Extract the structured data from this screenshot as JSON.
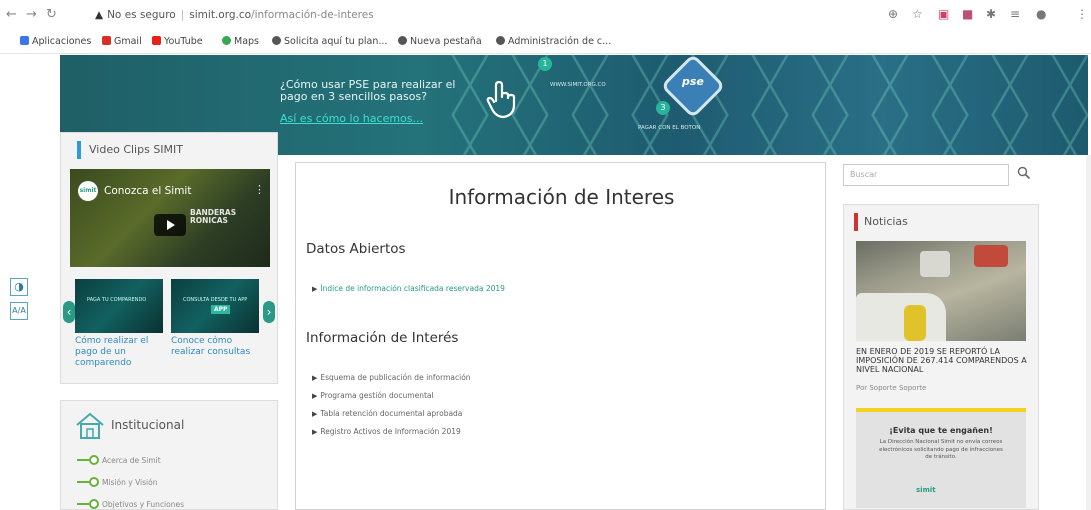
{
  "browser": {
    "security_label": "No es seguro",
    "url_domain": "simit.org.co",
    "url_path": "/información-de-interes"
  },
  "bookmarks": [
    {
      "label": "Aplicaciones",
      "color": "#3b78e7"
    },
    {
      "label": "Gmail",
      "color": "#d93025"
    },
    {
      "label": "YouTube",
      "color": "#e62117"
    },
    {
      "label": "Maps",
      "color": "#34a853"
    },
    {
      "label": "Solicita aquí tu plan...",
      "color": "#555555"
    },
    {
      "label": "Nueva pestaña",
      "color": "#555555"
    },
    {
      "label": "Administración de c...",
      "color": "#555555"
    }
  ],
  "banner": {
    "question": "¿Cómo usar PSE para realizar el pago en 3 sencillos pasos?",
    "link": "Así es cómo lo hacemos...",
    "pse": "pse",
    "small_url": "WWW.SIMIT.ORG.CO",
    "small_pay": "PAGAR CON EL BOTON"
  },
  "video_clips": {
    "title": "Video Clips SIMIT",
    "video_title": "Conozca el Simit",
    "logo": "simit",
    "overlay": "BANDERAS RONICAS",
    "thumbs": [
      {
        "caption": "Cómo realizar el pago de un comparendo",
        "text": "PAGA TU COMPARENDO"
      },
      {
        "caption": "Conoce cómo realizar consultas",
        "text": "CONSULTA DESDE TU APP",
        "app": "APP"
      }
    ]
  },
  "institucional": {
    "title": "Institucional",
    "items": [
      "Acerca de Simit",
      "Misión y Visión",
      "Objetivos y Funciones"
    ]
  },
  "main": {
    "title": "Información de Interes",
    "section1": "Datos Abiertos",
    "section1_links": [
      "Índice de información clasificada reservada 2019"
    ],
    "section2": "Información de Interés",
    "section2_links": [
      "Esquema de publicación de información",
      "Programa gestión documental",
      "Tabla retención documental aprobada",
      "Registro Activos de Información 2019"
    ]
  },
  "sidebar_right": {
    "search_placeholder": "Buscar",
    "news_title": "Noticias",
    "headline": "EN ENERO DE 2019 SE REPORTÓ LA IMPOSICIÓN DE 267.414 COMPARENDOS A NIVEL NACIONAL",
    "author": "Por Soporte Soporte",
    "ad_title": "¡Evita que te engañen!",
    "ad_body": "La Dirección Nacional Simit no envía correos electrónicos solicitando pago de infracciones de tránsito.",
    "ad_logo": "simit"
  },
  "accessibility": {
    "contrast": "◑",
    "text_size": "A/A"
  },
  "colors": {
    "accent_blue": "#2e9bd6",
    "link_teal": "#2a9a86",
    "news_red": "#d03434",
    "ad_yellow": "#f4d21e"
  }
}
